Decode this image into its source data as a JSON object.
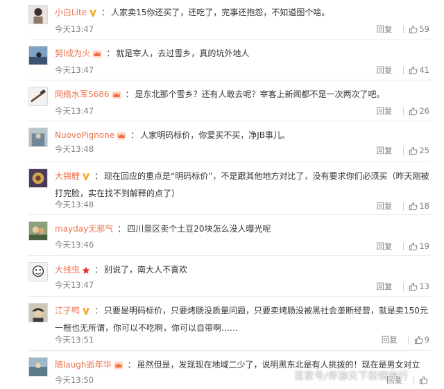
{
  "ui": {
    "reply_label": "回复",
    "separator": "|",
    "colors": {
      "username": "#eb7350",
      "meta": "#808080",
      "text": "#333333",
      "badge_gold": "#f5a623",
      "badge_red": "#e8312f"
    }
  },
  "comments": [
    {
      "username": "小白Lite",
      "badge": "gold-v-icon",
      "text": "人家卖15你还买了，还吃了，完事还抱怨，不知道图个啥。",
      "time": "今天13:47",
      "likes": "59"
    },
    {
      "username": "努l成为火",
      "badge": "crown-icon",
      "text": "就是宰人，去过雪乡，真的坑外地人",
      "time": "今天13:47",
      "likes": "41"
    },
    {
      "username": "网络水军S686",
      "badge": "crown-icon",
      "text": "是东北那个雪乡？还有人敢去呢？宰客上新闻都不是一次两次了吧。",
      "time": "今天13:47",
      "likes": "26"
    },
    {
      "username": "NuovoPignone",
      "badge": "crown-icon",
      "text": "人家明码标价，你爱买不买，净JB事儿。",
      "time": "今天13:48",
      "likes": "25"
    },
    {
      "username": "大锦鲤",
      "badge": "gold-v-icon",
      "text": "现在回应的重点是“明码标价”，不是跟其他地方对比了，没有要求你们必须买（昨天刚被打完脸，实在找不到解释的点了）",
      "time": "今天13:48",
      "likes": "18"
    },
    {
      "username": "mayday无邪气",
      "badge": "",
      "text": "四川景区卖个土豆20块怎么没人曝光呢",
      "time": "今天13:46",
      "likes": "19"
    },
    {
      "username": "大线虫",
      "badge": "red-star-icon",
      "text": "别说了，南大人不喜欢",
      "time": "今天13:47",
      "likes": "13"
    },
    {
      "username": "江子鸭",
      "badge": "gold-v-icon",
      "text": "只要是明码标价，只要烤肠没质量问题，只要卖烤肠没被黑社会垄断经营，就是卖150元一根也无所谓，你可以不吃啊，你可以自带啊……",
      "time": "今天13:51",
      "likes": "9"
    },
    {
      "username": "随laugh逝年华",
      "badge": "crown-icon",
      "text": "虽然但是，发现现在地域二少了，说明黑东北是有人挑拨的！现在是男女对立",
      "time": "今天13:50",
      "likes": ""
    }
  ],
  "watermark": "百家号/伴游天下和情旅行"
}
